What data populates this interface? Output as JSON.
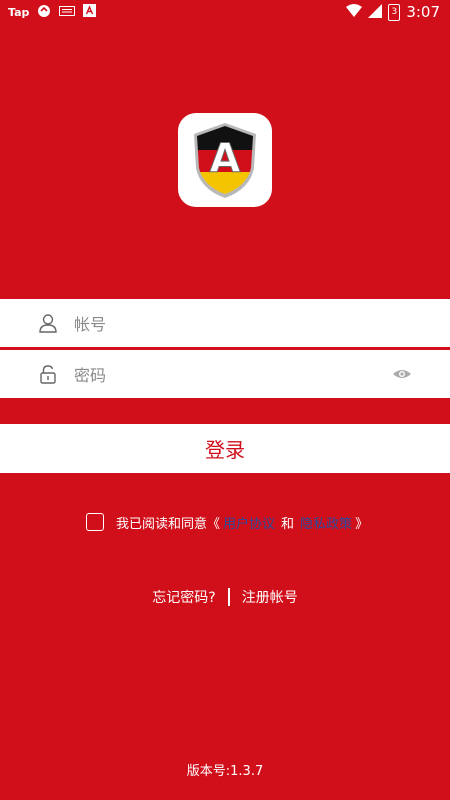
{
  "status_bar": {
    "carrier": "Tap",
    "time": "3:07",
    "battery": "3"
  },
  "logo": {
    "letter": "A"
  },
  "login_form": {
    "account_placeholder": "帐号",
    "password_placeholder": "密码",
    "login_label": "登录"
  },
  "agreement": {
    "prefix": "我已阅读和同意《",
    "user_agreement": "用户协议",
    "and": "和",
    "privacy_policy": "隐私政策",
    "suffix": "》"
  },
  "links": {
    "forgot_password": "忘记密码?",
    "register": "注册帐号"
  },
  "footer": {
    "version": "版本号:1.3.7"
  },
  "colors": {
    "background": "#d10f1b",
    "link": "#2a4a9a"
  }
}
